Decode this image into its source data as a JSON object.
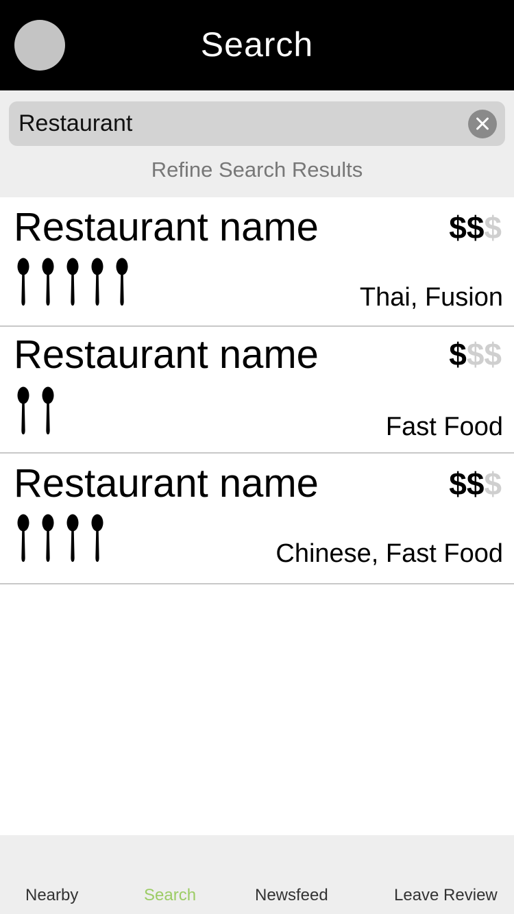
{
  "header": {
    "title": "Search"
  },
  "search": {
    "value": "Restaurant",
    "refine_label": "Refine Search Results"
  },
  "results": [
    {
      "name": "Restaurant name",
      "price_active": "$$",
      "price_inactive": "$",
      "price_level": 2,
      "rating": 5,
      "cuisine": "Thai, Fusion"
    },
    {
      "name": "Restaurant name",
      "price_active": "$",
      "price_inactive": "$$",
      "price_level": 1,
      "rating": 2,
      "cuisine": "Fast Food"
    },
    {
      "name": "Restaurant name",
      "price_active": "$$",
      "price_inactive": "$",
      "price_level": 2,
      "rating": 4,
      "cuisine": "Chinese, Fast Food"
    }
  ],
  "nav": {
    "items": [
      {
        "label": "Nearby"
      },
      {
        "label": "Search"
      },
      {
        "label": "Newsfeed"
      },
      {
        "label": "Leave Review"
      }
    ],
    "active": "Search"
  },
  "colors": {
    "header_bg": "#000000",
    "nav_active": "#9ccc65",
    "price_dim": "#cfcfcf"
  },
  "icons": {
    "rating": "spoon-icon",
    "clear": "close-icon"
  }
}
